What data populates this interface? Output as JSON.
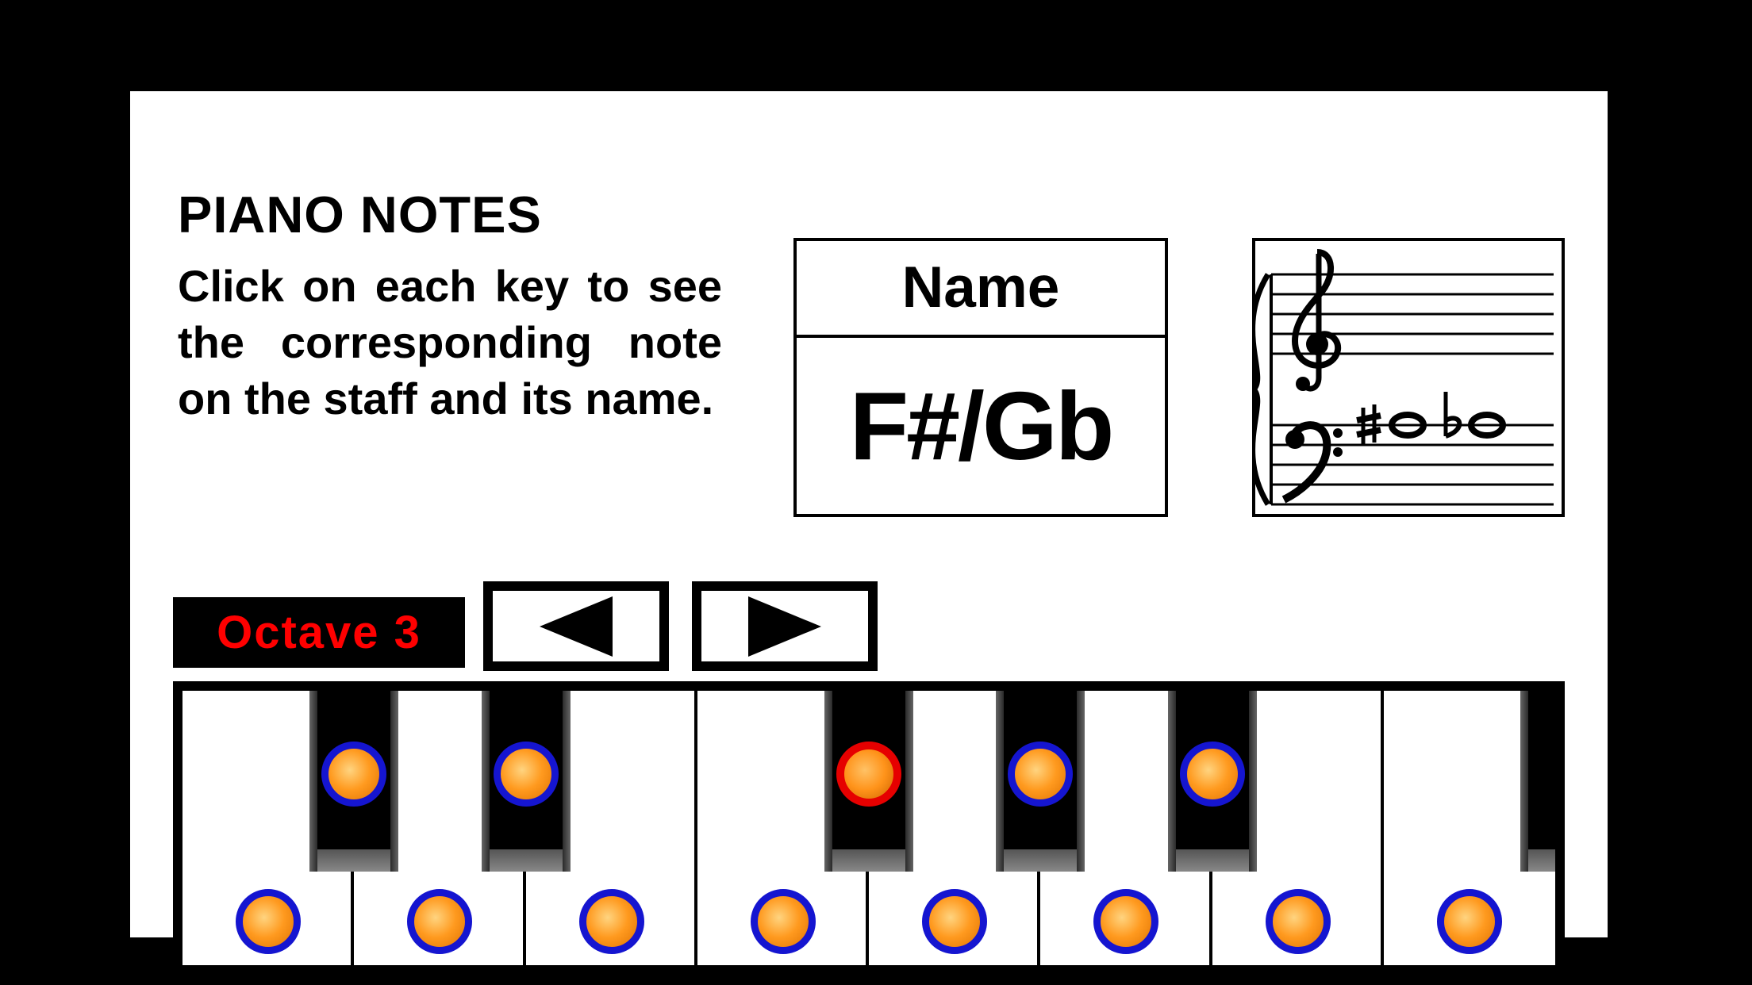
{
  "title": "PIANO NOTES",
  "instructions": "Click on each key to see the corresponding note on the staff and its name.",
  "name_header": "Name",
  "selected_note": "F#/Gb",
  "octave_label": "Octave 3",
  "nav": {
    "prev_icon": "triangle-left",
    "next_icon": "triangle-right"
  },
  "staff": {
    "clefs": [
      "treble",
      "bass"
    ],
    "display": {
      "clef": "bass",
      "accidentals": [
        "sharp",
        "flat"
      ],
      "line": 2
    }
  },
  "keyboard": {
    "white_keys": [
      {
        "note": "C",
        "selected": false
      },
      {
        "note": "D",
        "selected": false
      },
      {
        "note": "E",
        "selected": false
      },
      {
        "note": "F",
        "selected": false
      },
      {
        "note": "G",
        "selected": false
      },
      {
        "note": "A",
        "selected": false
      },
      {
        "note": "B",
        "selected": false
      },
      {
        "note": "C",
        "selected": false
      }
    ],
    "black_keys": [
      {
        "note": "C#/Db",
        "after_white_index": 0,
        "selected": false
      },
      {
        "note": "D#/Eb",
        "after_white_index": 1,
        "selected": false
      },
      {
        "note": "F#/Gb",
        "after_white_index": 3,
        "selected": true
      },
      {
        "note": "G#/Ab",
        "after_white_index": 4,
        "selected": false
      },
      {
        "note": "A#/Bb",
        "after_white_index": 5,
        "selected": false
      }
    ],
    "extra_black_fragment_right": true
  }
}
